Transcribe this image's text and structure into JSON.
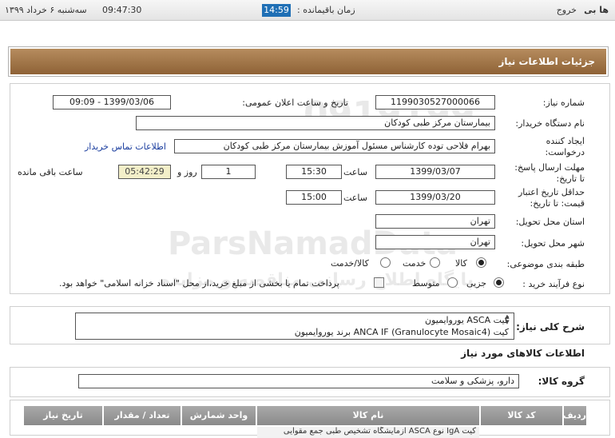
{
  "topbar": {
    "username": "ها بی",
    "logout": "خروج",
    "remaining_label": "زمان باقیمانده :",
    "timer": "14:59",
    "clock": "09:47:30",
    "date": "سه‌شنبه ۶ خرداد ۱۳۹۹"
  },
  "panel": {
    "title": "جزئیات اطلاعات نیاز"
  },
  "form": {
    "need_number_label": "شماره نیاز:",
    "need_number": "1199030527000066",
    "announce_label": "تاریخ و ساعت اعلان عمومی:",
    "announce_value": "1399/03/06 - 09:09",
    "buyer_label": "نام دستگاه خریدار:",
    "buyer_value": "بیمارستان مرکز طبی کودکان",
    "creator_label_1": "ایجاد کننده",
    "creator_label_2": "درخواست:",
    "creator_value": "بهرام فلاحی توده کارشناس مسئول آموزش بیمارستان مرکز طبی کودکان",
    "contact_link": "اطلاعات تماس خریدار",
    "deadline_label_1": "مهلت ارسال پاسخ:",
    "deadline_label_2": "تا تاریخ:",
    "deadline_date": "1399/03/07",
    "time_label": "ساعت",
    "deadline_time": "15:30",
    "days_value": "1",
    "days_label": "روز و",
    "remaining_time": "05:42:29",
    "remaining_label": "ساعت باقی مانده",
    "validity_label_1": "حداقل تاریخ اعتبار",
    "validity_label_2": "قیمت: تا تاریخ:",
    "validity_date": "1399/03/20",
    "validity_time": "15:00",
    "province_label": "استان محل تحویل:",
    "province_value": "تهران",
    "city_label": "شهر محل تحویل:",
    "city_value": "تهران",
    "category_label": "طبقه بندی موضوعی:",
    "category_options": [
      "کالا",
      "خدمت",
      "کالا/خدمت"
    ],
    "process_label": "نوع فرآیند خرید :",
    "process_options": [
      "جزیی",
      "متوسط"
    ],
    "payment_note": "پرداخت تمام یا بخشی از مبلغ خرید،از محل \"اسناد خزانه اسلامی\" خواهد بود."
  },
  "description": {
    "label": "شرح کلی نیاز:",
    "line1": "کیت ASCA یوروایمیون",
    "line2": "کیت ANCA IF (Granulocyte Mosaic4)  برند یوروایمیون"
  },
  "goods": {
    "section_title": "اطلاعات کالاهای مورد نیاز",
    "group_label": "گروه کالا:",
    "group_value": "دارو، پزشکی و سلامت",
    "columns": [
      "ردیف",
      "کد کالا",
      "نام کالا",
      "واحد شمارش",
      "تعداد / مقدار",
      "تاریخ نیاز"
    ],
    "row1_name": "کیت IgA نوع ASCA آزمایشگاه تشخیص طبی جمع مقوایی"
  },
  "watermark": {
    "number": "0919199",
    "brand": "ParsNamadData",
    "tagline": "پایگاه اطلاع رسانی مناقصه و مزایده",
    "phone": "۰۲۱-۸۸۳۴۹۶۷۰-۵"
  }
}
